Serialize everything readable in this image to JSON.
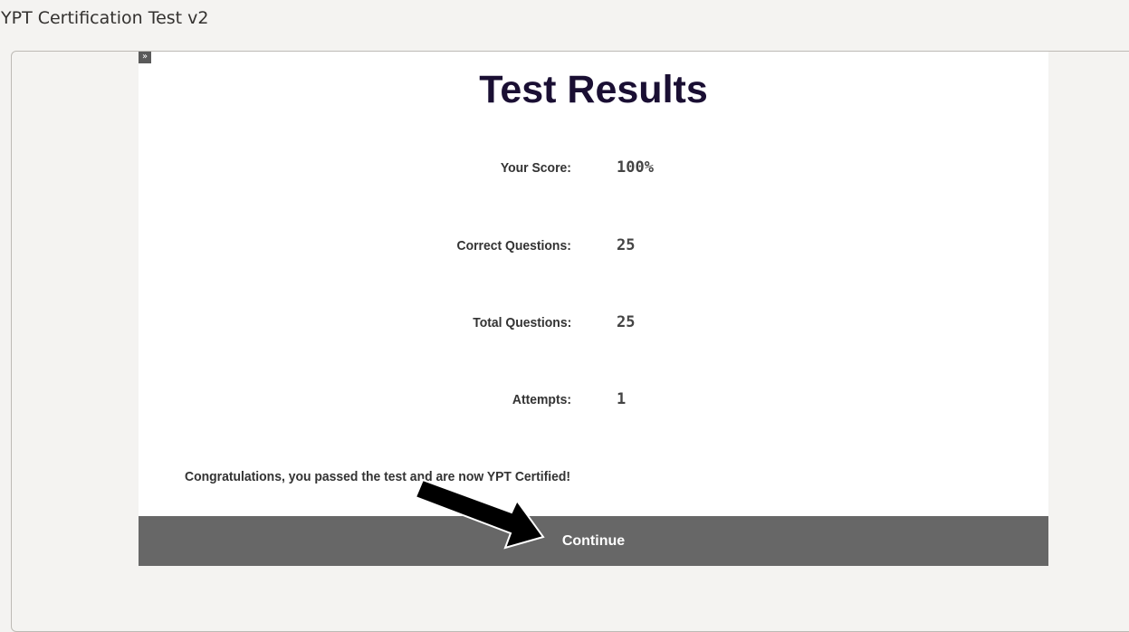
{
  "window": {
    "title": "YPT Certification Test v2"
  },
  "sidebar_toggle": {
    "glyph": "»",
    "icon": "double-chevron-right-icon"
  },
  "results": {
    "heading": "Test Results",
    "stats": [
      {
        "label": "Your Score:",
        "value": "100%"
      },
      {
        "label": "Correct Questions:",
        "value": "25"
      },
      {
        "label": "Total Questions:",
        "value": "25"
      },
      {
        "label": "Attempts:",
        "value": "1"
      }
    ],
    "message": "Congratulations, you passed the test and are now YPT Certified!",
    "continue_label": "Continue"
  },
  "annotation": {
    "icon": "pointer-arrow-icon",
    "color": "#000000"
  },
  "colors": {
    "heading": "#1a0f33",
    "continue_bar": "#676767",
    "background": "#f4f3f1"
  }
}
